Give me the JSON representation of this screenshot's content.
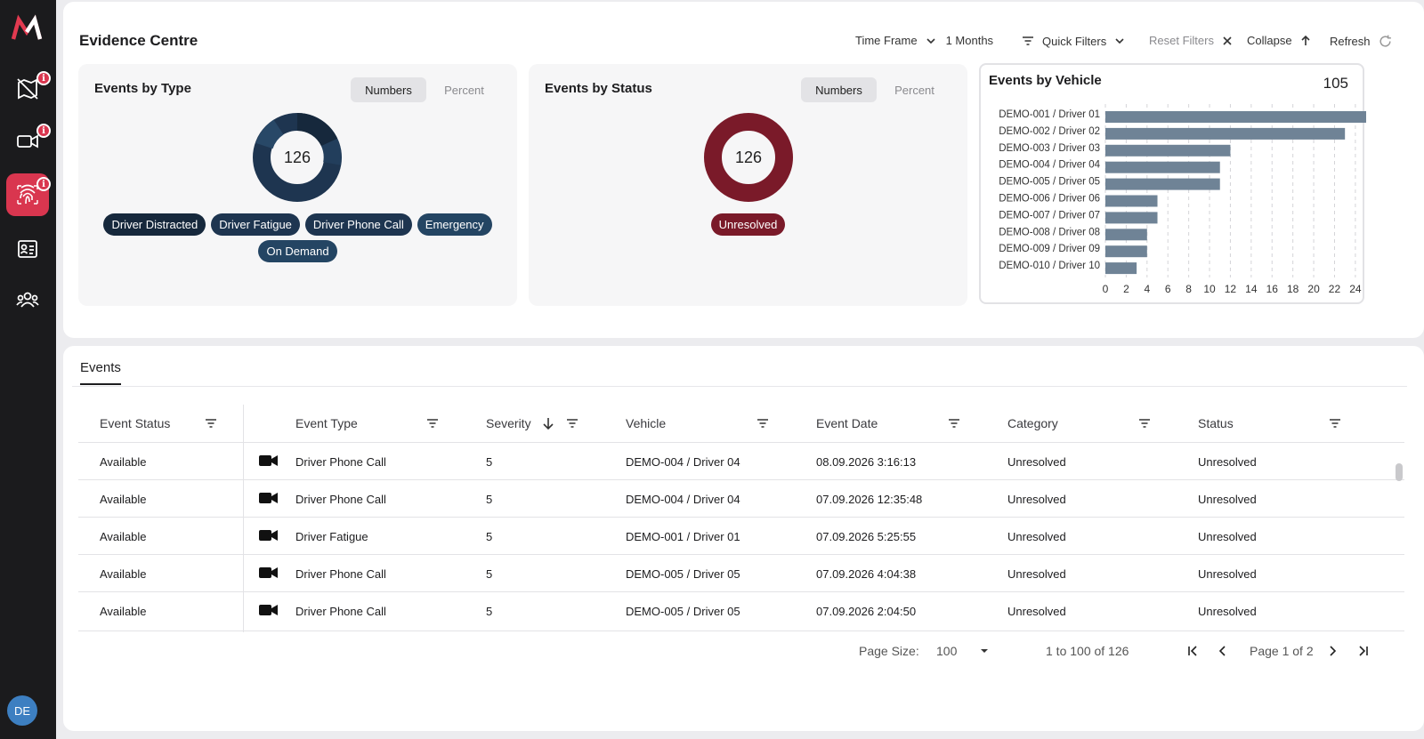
{
  "sidebar": {
    "logo": "M",
    "items": [
      {
        "icon": "map-off-icon",
        "badge": "i"
      },
      {
        "icon": "video-camera-icon",
        "badge": "i"
      },
      {
        "icon": "fingerprint-icon",
        "badge": "i",
        "active": true
      },
      {
        "icon": "id-card-icon"
      },
      {
        "icon": "users-icon"
      }
    ],
    "avatar": "DE"
  },
  "header": {
    "title": "Evidence Centre",
    "time_frame_label": "Time Frame",
    "time_frame_value": "1 Months",
    "quick_filters": "Quick Filters",
    "reset_filters": "Reset Filters",
    "collapse": "Collapse",
    "refresh": "Refresh"
  },
  "events_by_type": {
    "title": "Events by Type",
    "toggle": [
      "Numbers",
      "Percent"
    ],
    "total": "126",
    "chips": [
      "Driver Distracted",
      "Driver Fatigue",
      "Driver Phone Call",
      "Emergency",
      "On Demand"
    ]
  },
  "events_by_status": {
    "title": "Events by Status",
    "toggle": [
      "Numbers",
      "Percent"
    ],
    "total": "126",
    "chips": [
      "Unresolved"
    ]
  },
  "events_by_vehicle": {
    "title": "Events by Vehicle",
    "total": "105"
  },
  "chart_data": {
    "type": "bar",
    "orientation": "horizontal",
    "title": "Events by Vehicle",
    "categories": [
      "DEMO-001 / Driver 01",
      "DEMO-002 / Driver 02",
      "DEMO-003 / Driver 03",
      "DEMO-004 / Driver 04",
      "DEMO-005 / Driver 05",
      "DEMO-006 / Driver 06",
      "DEMO-007 / Driver 07",
      "DEMO-008 / Driver 08",
      "DEMO-009 / Driver 09",
      "DEMO-010 / Driver 10"
    ],
    "values": [
      27,
      23,
      12,
      11,
      11,
      5,
      5,
      4,
      4,
      3
    ],
    "xticks": [
      "0",
      "2",
      "4",
      "6",
      "8",
      "10",
      "12",
      "14",
      "16",
      "18",
      "20",
      "22",
      "24",
      "26"
    ],
    "xlim": [
      0,
      27
    ],
    "grid": true,
    "bar_color": "#6f8396"
  },
  "events_table": {
    "tab": "Events",
    "columns": [
      "Event Status",
      "Event Type",
      "Severity",
      "Vehicle",
      "Event Date",
      "Category",
      "Status"
    ],
    "rows": [
      {
        "event_status": "Available",
        "event_type": "Driver Phone Call",
        "severity": "5",
        "vehicle": "DEMO-004 / Driver 04",
        "event_date": "08.09.2026 3:16:13",
        "category": "Unresolved",
        "status": "Unresolved"
      },
      {
        "event_status": "Available",
        "event_type": "Driver Phone Call",
        "severity": "5",
        "vehicle": "DEMO-004 / Driver 04",
        "event_date": "07.09.2026 12:35:48",
        "category": "Unresolved",
        "status": "Unresolved"
      },
      {
        "event_status": "Available",
        "event_type": "Driver Fatigue",
        "severity": "5",
        "vehicle": "DEMO-001 / Driver 01",
        "event_date": "07.09.2026 5:25:55",
        "category": "Unresolved",
        "status": "Unresolved"
      },
      {
        "event_status": "Available",
        "event_type": "Driver Phone Call",
        "severity": "5",
        "vehicle": "DEMO-005 / Driver 05",
        "event_date": "07.09.2026 4:04:38",
        "category": "Unresolved",
        "status": "Unresolved"
      },
      {
        "event_status": "Available",
        "event_type": "Driver Phone Call",
        "severity": "5",
        "vehicle": "DEMO-005 / Driver 05",
        "event_date": "07.09.2026 2:04:50",
        "category": "Unresolved",
        "status": "Unresolved"
      }
    ]
  },
  "pagination": {
    "page_size_label": "Page Size:",
    "page_size_value": "100",
    "range": "1 to 100 of 126",
    "page": "Page 1 of 2"
  },
  "colors": {
    "accent": "#d9364f",
    "navy": "#1e3550",
    "wine": "#7a1a29"
  }
}
